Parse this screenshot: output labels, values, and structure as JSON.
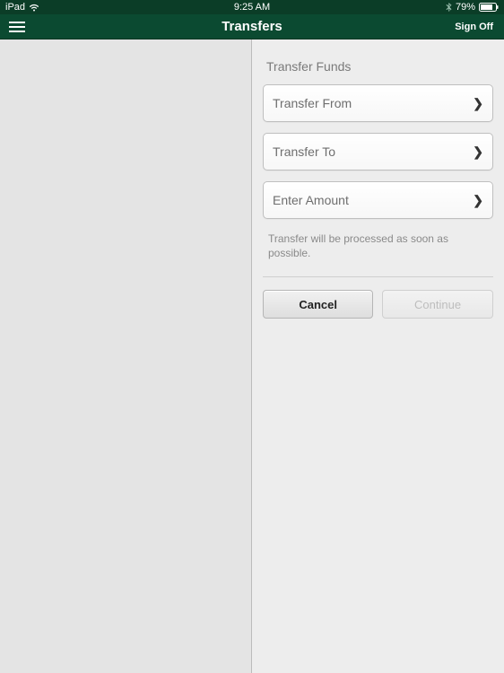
{
  "status": {
    "carrier": "iPad",
    "time": "9:25 AM",
    "battery_pct": "79%"
  },
  "nav": {
    "title": "Transfers",
    "signoff_label": "Sign Off"
  },
  "form": {
    "section_title": "Transfer Funds",
    "rows": {
      "from": "Transfer From",
      "to": "Transfer To",
      "amount": "Enter Amount"
    },
    "hint": "Transfer will be processed as soon as possible.",
    "buttons": {
      "cancel": "Cancel",
      "continue": "Continue"
    }
  }
}
